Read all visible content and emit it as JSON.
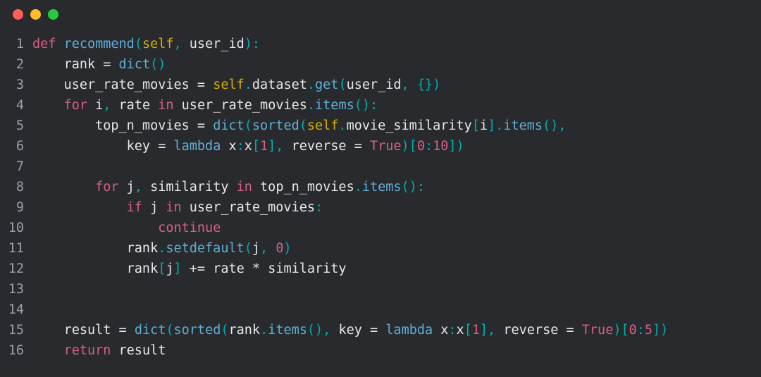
{
  "window": {
    "traffic_lights": [
      "close",
      "minimize",
      "zoom"
    ]
  },
  "code": {
    "language": "python",
    "lines": [
      {
        "n": 1,
        "indent": 0,
        "tokens": [
          [
            "kw",
            "def "
          ],
          [
            "fn",
            "recommend"
          ],
          [
            "punct",
            "("
          ],
          [
            "self",
            "self"
          ],
          [
            "punct",
            ", "
          ],
          [
            "param",
            "user_id"
          ],
          [
            "punct",
            "):"
          ]
        ]
      },
      {
        "n": 2,
        "indent": 1,
        "tokens": [
          [
            "ident",
            "rank "
          ],
          [
            "op",
            "= "
          ],
          [
            "builtin",
            "dict"
          ],
          [
            "punct",
            "()"
          ]
        ]
      },
      {
        "n": 3,
        "indent": 1,
        "tokens": [
          [
            "ident",
            "user_rate_movies "
          ],
          [
            "op",
            "= "
          ],
          [
            "self",
            "self"
          ],
          [
            "punct",
            "."
          ],
          [
            "attr",
            "dataset"
          ],
          [
            "punct",
            "."
          ],
          [
            "fn",
            "get"
          ],
          [
            "punct",
            "("
          ],
          [
            "ident",
            "user_id"
          ],
          [
            "punct",
            ", {})"
          ]
        ]
      },
      {
        "n": 4,
        "indent": 1,
        "tokens": [
          [
            "kw",
            "for "
          ],
          [
            "ident",
            "i"
          ],
          [
            "punct",
            ", "
          ],
          [
            "ident",
            "rate "
          ],
          [
            "kw",
            "in "
          ],
          [
            "ident",
            "user_rate_movies"
          ],
          [
            "punct",
            "."
          ],
          [
            "fn",
            "items"
          ],
          [
            "punct",
            "():"
          ]
        ]
      },
      {
        "n": 5,
        "indent": 2,
        "tokens": [
          [
            "ident",
            "top_n_movies "
          ],
          [
            "op",
            "= "
          ],
          [
            "builtin",
            "dict"
          ],
          [
            "punct",
            "("
          ],
          [
            "builtin",
            "sorted"
          ],
          [
            "punct",
            "("
          ],
          [
            "self",
            "self"
          ],
          [
            "punct",
            "."
          ],
          [
            "attr",
            "movie_similarity"
          ],
          [
            "punct",
            "["
          ],
          [
            "ident",
            "i"
          ],
          [
            "punct",
            "]."
          ],
          [
            "fn",
            "items"
          ],
          [
            "punct",
            "(),"
          ]
        ]
      },
      {
        "n": 6,
        "indent": 3,
        "tokens": [
          [
            "ident",
            "key "
          ],
          [
            "op",
            "= "
          ],
          [
            "lamb",
            "lambda "
          ],
          [
            "ident",
            "x"
          ],
          [
            "punct",
            ":"
          ],
          [
            "ident",
            "x"
          ],
          [
            "punct",
            "["
          ],
          [
            "num",
            "1"
          ],
          [
            "punct",
            "], "
          ],
          [
            "ident",
            "reverse "
          ],
          [
            "op",
            "= "
          ],
          [
            "bool",
            "True"
          ],
          [
            "punct",
            ")["
          ],
          [
            "num",
            "0"
          ],
          [
            "punct",
            ":"
          ],
          [
            "num",
            "10"
          ],
          [
            "punct",
            "])"
          ]
        ]
      },
      {
        "n": 7,
        "indent": 0,
        "tokens": []
      },
      {
        "n": 8,
        "indent": 2,
        "tokens": [
          [
            "kw",
            "for "
          ],
          [
            "ident",
            "j"
          ],
          [
            "punct",
            ", "
          ],
          [
            "ident",
            "similarity "
          ],
          [
            "kw",
            "in "
          ],
          [
            "ident",
            "top_n_movies"
          ],
          [
            "punct",
            "."
          ],
          [
            "fn",
            "items"
          ],
          [
            "punct",
            "():"
          ]
        ]
      },
      {
        "n": 9,
        "indent": 3,
        "tokens": [
          [
            "kw",
            "if "
          ],
          [
            "ident",
            "j "
          ],
          [
            "kw",
            "in "
          ],
          [
            "ident",
            "user_rate_movies"
          ],
          [
            "punct",
            ":"
          ]
        ]
      },
      {
        "n": 10,
        "indent": 4,
        "tokens": [
          [
            "kw",
            "continue"
          ]
        ]
      },
      {
        "n": 11,
        "indent": 3,
        "tokens": [
          [
            "ident",
            "rank"
          ],
          [
            "punct",
            "."
          ],
          [
            "fn",
            "setdefault"
          ],
          [
            "punct",
            "("
          ],
          [
            "ident",
            "j"
          ],
          [
            "punct",
            ", "
          ],
          [
            "num",
            "0"
          ],
          [
            "punct",
            ")"
          ]
        ]
      },
      {
        "n": 12,
        "indent": 3,
        "tokens": [
          [
            "ident",
            "rank"
          ],
          [
            "punct",
            "["
          ],
          [
            "ident",
            "j"
          ],
          [
            "punct",
            "] "
          ],
          [
            "op",
            "+= "
          ],
          [
            "ident",
            "rate "
          ],
          [
            "op",
            "* "
          ],
          [
            "ident",
            "similarity"
          ]
        ]
      },
      {
        "n": 13,
        "indent": 0,
        "tokens": []
      },
      {
        "n": 14,
        "indent": 0,
        "tokens": []
      },
      {
        "n": 15,
        "indent": 1,
        "tokens": [
          [
            "ident",
            "result "
          ],
          [
            "op",
            "= "
          ],
          [
            "builtin",
            "dict"
          ],
          [
            "punct",
            "("
          ],
          [
            "builtin",
            "sorted"
          ],
          [
            "punct",
            "("
          ],
          [
            "ident",
            "rank"
          ],
          [
            "punct",
            "."
          ],
          [
            "fn",
            "items"
          ],
          [
            "punct",
            "(), "
          ],
          [
            "ident",
            "key "
          ],
          [
            "op",
            "= "
          ],
          [
            "lamb",
            "lambda "
          ],
          [
            "ident",
            "x"
          ],
          [
            "punct",
            ":"
          ],
          [
            "ident",
            "x"
          ],
          [
            "punct",
            "["
          ],
          [
            "num",
            "1"
          ],
          [
            "punct",
            "], "
          ],
          [
            "ident",
            "reverse "
          ],
          [
            "op",
            "= "
          ],
          [
            "bool",
            "True"
          ],
          [
            "punct",
            ")["
          ],
          [
            "num",
            "0"
          ],
          [
            "punct",
            ":"
          ],
          [
            "num",
            "5"
          ],
          [
            "punct",
            "])"
          ]
        ]
      },
      {
        "n": 16,
        "indent": 1,
        "tokens": [
          [
            "kw",
            "return "
          ],
          [
            "ident",
            "result"
          ]
        ]
      }
    ]
  }
}
